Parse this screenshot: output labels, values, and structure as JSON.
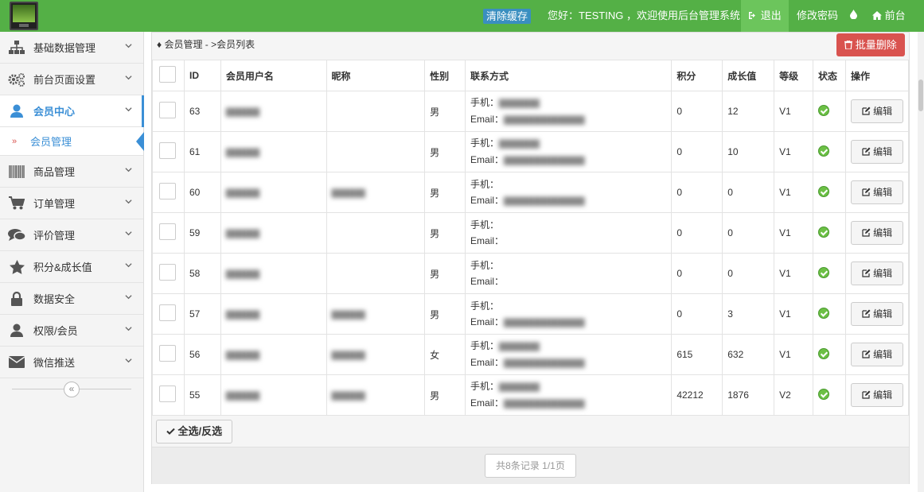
{
  "header": {
    "clear_cache": "清除缓存",
    "greeting": "您好：TESTING ，欢迎使用后台管理系统！",
    "logout": "退出",
    "change_password": "修改密码",
    "front": "前台",
    "bg_color": "#54b046"
  },
  "sidebar": {
    "items": [
      {
        "label": "基础数据管理",
        "icon": "sitemap-icon"
      },
      {
        "label": "前台页面设置",
        "icon": "gears-icon"
      },
      {
        "label": "会员中心",
        "icon": "user-icon",
        "active": true
      },
      {
        "label": "商品管理",
        "icon": "barcode-icon"
      },
      {
        "label": "订单管理",
        "icon": "cart-icon"
      },
      {
        "label": "评价管理",
        "icon": "comments-icon"
      },
      {
        "label": "积分&成长值",
        "icon": "star-icon"
      },
      {
        "label": "数据安全",
        "icon": "lock-icon"
      },
      {
        "label": "权限/会员",
        "icon": "user-icon"
      },
      {
        "label": "微信推送",
        "icon": "envelope-icon"
      }
    ],
    "sub_item": "会员管理"
  },
  "breadcrumb": "会员管理 - >会员列表",
  "batch_delete": "批量删除",
  "table": {
    "headers": [
      "ID",
      "会员用户名",
      "昵称",
      "性别",
      "联系方式",
      "积分",
      "成长值",
      "等级",
      "状态",
      "操作"
    ],
    "phone_label": "手机：",
    "email_label": "Email：",
    "edit_label": "编辑",
    "rows": [
      {
        "id": "63",
        "gender": "男",
        "points": "0",
        "growth": "12",
        "level": "V1"
      },
      {
        "id": "61",
        "gender": "男",
        "points": "0",
        "growth": "10",
        "level": "V1"
      },
      {
        "id": "60",
        "gender": "男",
        "points": "0",
        "growth": "0",
        "level": "V1"
      },
      {
        "id": "59",
        "gender": "男",
        "points": "0",
        "growth": "0",
        "level": "V1"
      },
      {
        "id": "58",
        "gender": "男",
        "points": "0",
        "growth": "0",
        "level": "V1"
      },
      {
        "id": "57",
        "gender": "男",
        "points": "0",
        "growth": "3",
        "level": "V1"
      },
      {
        "id": "56",
        "gender": "女",
        "points": "615",
        "growth": "632",
        "level": "V1"
      },
      {
        "id": "55",
        "gender": "男",
        "points": "42212",
        "growth": "1876",
        "level": "V2"
      }
    ]
  },
  "select_all": "全选/反选",
  "pager": "共8条记录 1/1页"
}
